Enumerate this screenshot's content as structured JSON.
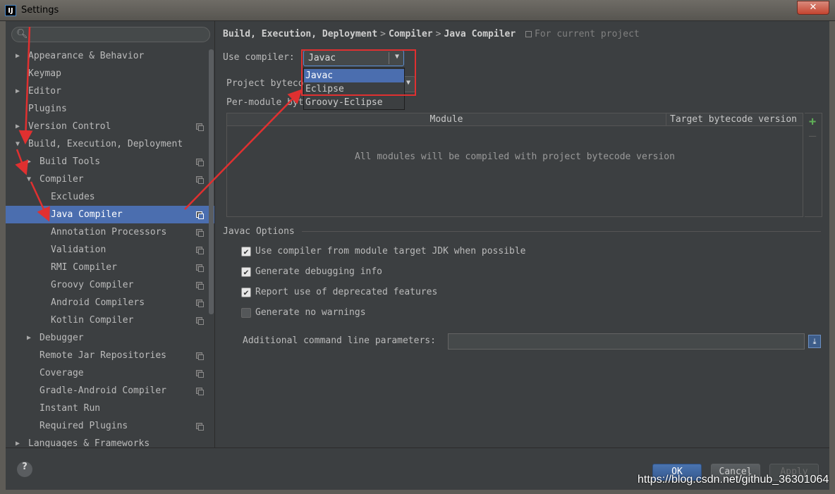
{
  "window": {
    "title": "Settings",
    "close_label": "✕",
    "app_icon_label": "IJ"
  },
  "search": {
    "value": "",
    "placeholder": ""
  },
  "sidebar": {
    "items": [
      {
        "label": "Appearance & Behavior",
        "arrow": "▶"
      },
      {
        "label": "Keymap",
        "arrow": ""
      },
      {
        "label": "Editor",
        "arrow": "▶"
      },
      {
        "label": "Plugins",
        "arrow": ""
      },
      {
        "label": "Version Control",
        "arrow": "▶"
      },
      {
        "label": "Build, Execution, Deployment",
        "arrow": "▼"
      },
      {
        "label": "Build Tools",
        "arrow": "▶"
      },
      {
        "label": "Compiler",
        "arrow": "▼"
      },
      {
        "label": "Excludes",
        "arrow": ""
      },
      {
        "label": "Java Compiler",
        "arrow": "",
        "selected": true
      },
      {
        "label": "Annotation Processors",
        "arrow": ""
      },
      {
        "label": "Validation",
        "arrow": ""
      },
      {
        "label": "RMI Compiler",
        "arrow": ""
      },
      {
        "label": "Groovy Compiler",
        "arrow": ""
      },
      {
        "label": "Android Compilers",
        "arrow": ""
      },
      {
        "label": "Kotlin Compiler",
        "arrow": ""
      },
      {
        "label": "Debugger",
        "arrow": "▶"
      },
      {
        "label": "Remote Jar Repositories",
        "arrow": ""
      },
      {
        "label": "Coverage",
        "arrow": ""
      },
      {
        "label": "Gradle-Android Compiler",
        "arrow": ""
      },
      {
        "label": "Instant Run",
        "arrow": ""
      },
      {
        "label": "Required Plugins",
        "arrow": ""
      },
      {
        "label": "Languages & Frameworks",
        "arrow": "▶"
      }
    ]
  },
  "breadcrumb": {
    "parts": [
      "Build, Execution, Deployment",
      "Compiler",
      "Java Compiler"
    ],
    "separator": ">",
    "hint": "For current project"
  },
  "compiler": {
    "label": "Use compiler:",
    "value": "Javac",
    "options": [
      "Javac",
      "Eclipse",
      "Groovy-Eclipse"
    ]
  },
  "bytecode": {
    "project_label": "Project byteco",
    "per_module_label": "Per-module byt"
  },
  "modules_table": {
    "columns": [
      "Module",
      "Target bytecode version"
    ],
    "empty_text": "All modules will be compiled with project bytecode version"
  },
  "javac_options": {
    "title": "Javac Options",
    "checkboxes": [
      {
        "label": "Use compiler from module target JDK when possible",
        "checked": true
      },
      {
        "label": "Generate debugging info",
        "checked": true
      },
      {
        "label": "Report use of deprecated features",
        "checked": true
      },
      {
        "label": "Generate no warnings",
        "checked": false
      }
    ],
    "params_label": "Additional command line parameters:",
    "params_value": ""
  },
  "footer": {
    "help": "?",
    "ok": "OK",
    "cancel": "Cancel",
    "apply": "Apply"
  },
  "watermark": "https://blog.csdn.net/github_36301064",
  "colors": {
    "background": "#3c3f41",
    "selection": "#4b6eaf",
    "annotation": "#e03030"
  }
}
